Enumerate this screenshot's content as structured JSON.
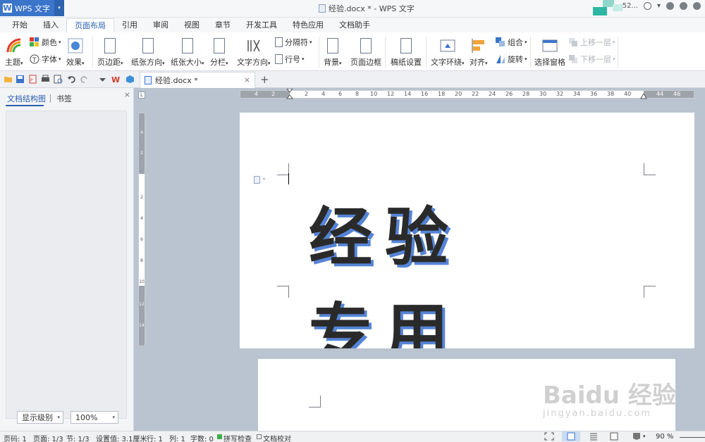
{
  "app": {
    "name": "WPS 文字",
    "logo_letter": "W",
    "dropdown": "▾"
  },
  "window": {
    "title": "经验.docx * - WPS 文字",
    "user_short": "52...",
    "arrow": "▾"
  },
  "menu": {
    "tabs": [
      "开始",
      "插入",
      "页面布局",
      "引用",
      "审阅",
      "视图",
      "章节",
      "开发工具",
      "特色应用",
      "文档助手"
    ],
    "active": "页面布局"
  },
  "ribbon": {
    "theme": "主题",
    "colors": "颜色",
    "fonts": "字体",
    "effects": "效果",
    "margins": "页边距",
    "orientation": "纸张方向",
    "size": "纸张大小",
    "columns": "分栏",
    "text_direction": "文字方向",
    "breaks": "分隔符",
    "line_numbers": "行号",
    "background": "背景",
    "page_border": "页面边框",
    "paper_settings": "稿纸设置",
    "wrap_text": "文字环绕",
    "align": "对齐",
    "group": "组合",
    "rotate": "旋转",
    "selection_pane": "选择窗格",
    "bring_forward": "上移一层",
    "send_backward": "下移一层",
    "dd": "▾"
  },
  "doc_tab": {
    "label": "经验.docx *",
    "close": "×",
    "add": "+"
  },
  "left_panel": {
    "tab_outline": "文档结构图",
    "tab_bookmarks": "书签",
    "close": "×",
    "level_select": "显示级别",
    "zoom_select": "100%"
  },
  "ruler": {
    "corner": "L",
    "h_left": [
      "4",
      "2"
    ],
    "h_main": [
      "2",
      "4",
      "6",
      "8",
      "10",
      "12",
      "14",
      "16",
      "18",
      "20",
      "22",
      "24",
      "26",
      "28",
      "30",
      "32",
      "34",
      "36",
      "38",
      "40"
    ],
    "h_right": [
      "44",
      "46"
    ],
    "v_top": [
      "4",
      "2"
    ],
    "v_main": [
      "2",
      "4",
      "6",
      "8",
      "10",
      "12",
      "14"
    ]
  },
  "document": {
    "line1": "经验",
    "line2": "专用"
  },
  "watermark": {
    "brand": "Baidu 经验",
    "url": "jingyan.baidu.com"
  },
  "status": {
    "page_no": "页码: 1",
    "pages": "页面: 1/3",
    "section": "节: 1/3",
    "setting": "设置值: 3.1厘米",
    "row": "行: 1",
    "col": "列: 1",
    "words": "字数: 0",
    "spell": "拼写检查",
    "proof": "文档校对",
    "zoom": "90 %"
  },
  "colors": {
    "accent": "#3b75c9",
    "shadow": "#5584d6",
    "teal": "#2fb7a4"
  }
}
